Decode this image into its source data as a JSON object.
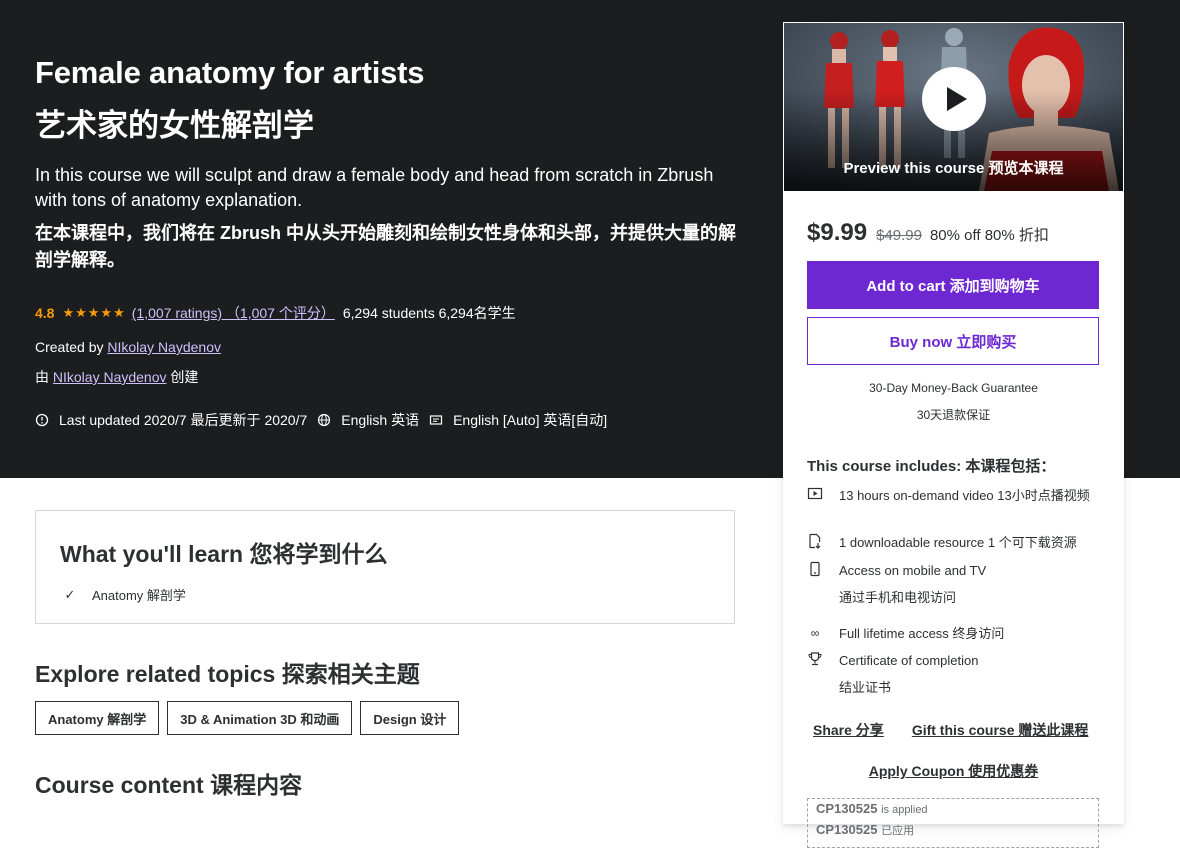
{
  "hero": {
    "title_en": "Female anatomy for artists",
    "title_zh": "艺术家的女性解剖学",
    "description_en": "In this course we will sculpt and draw a female body and head from scratch in Zbrush with tons of anatomy explanation.",
    "description_zh": "在本课程中，我们将在 Zbrush 中从头开始雕刻和绘制女性身体和头部，并提供大量的解剖学解释。",
    "rating": "4.8",
    "stars": "★★★★★",
    "ratings_link": "(1,007 ratings) （1,007 个评分）",
    "students": "6,294 students  6,294名学生",
    "created_by_label": "Created by",
    "instructor": "NIkolay Naydenov",
    "created_zh_prefix": "由",
    "created_zh_suffix": "创建",
    "last_updated": "Last updated 2020/7  最后更新于 2020/7",
    "language": "English  英语",
    "captions": "English [Auto]  英语[自动]"
  },
  "sidebar": {
    "preview_label": "Preview this course  预览本课程",
    "price": "$9.99",
    "original_price": "$49.99",
    "discount": "80% off  80% 折扣",
    "add_to_cart": "Add to cart  添加到购物车",
    "buy_now": "Buy now  立即购买",
    "guarantee_en": "30-Day Money-Back Guarantee",
    "guarantee_zh": "30天退款保证",
    "includes_title": "This course includes:  本课程包括：",
    "includes": [
      {
        "icon": "video-icon",
        "text": "13 hours on-demand video  13小时点播视频"
      },
      {
        "icon": "file-download-icon",
        "text": "1 downloadable resource  1 个可下载资源"
      },
      {
        "icon": "mobile-icon",
        "text": "Access on mobile and TV",
        "text2": "通过手机和电视访问"
      },
      {
        "icon": "infinity-icon",
        "text": "Full lifetime access  终身访问"
      },
      {
        "icon": "trophy-icon",
        "text": "Certificate of completion",
        "text2": "结业证书"
      }
    ],
    "share": "Share  分享",
    "gift": "Gift this course  赠送此课程",
    "apply_coupon": "Apply Coupon  使用优惠券",
    "coupon_code": "CP130525",
    "coupon_applied_en": "is applied",
    "coupon_applied_zh": "已应用"
  },
  "learn": {
    "title": "What you'll learn  您将学到什么",
    "items": [
      "Anatomy  解剖学"
    ]
  },
  "related": {
    "title": "Explore related topics  探索相关主题",
    "topics": [
      "Anatomy  解剖学",
      "3D & Animation  3D 和动画",
      "Design  设计"
    ]
  },
  "content": {
    "title": "Course content  课程内容"
  },
  "colors": {
    "hero_bg": "#1c1d1f",
    "accent_purple": "#6d28d2",
    "star_orange": "#f69c08",
    "link_lavender": "#cec0fc"
  }
}
